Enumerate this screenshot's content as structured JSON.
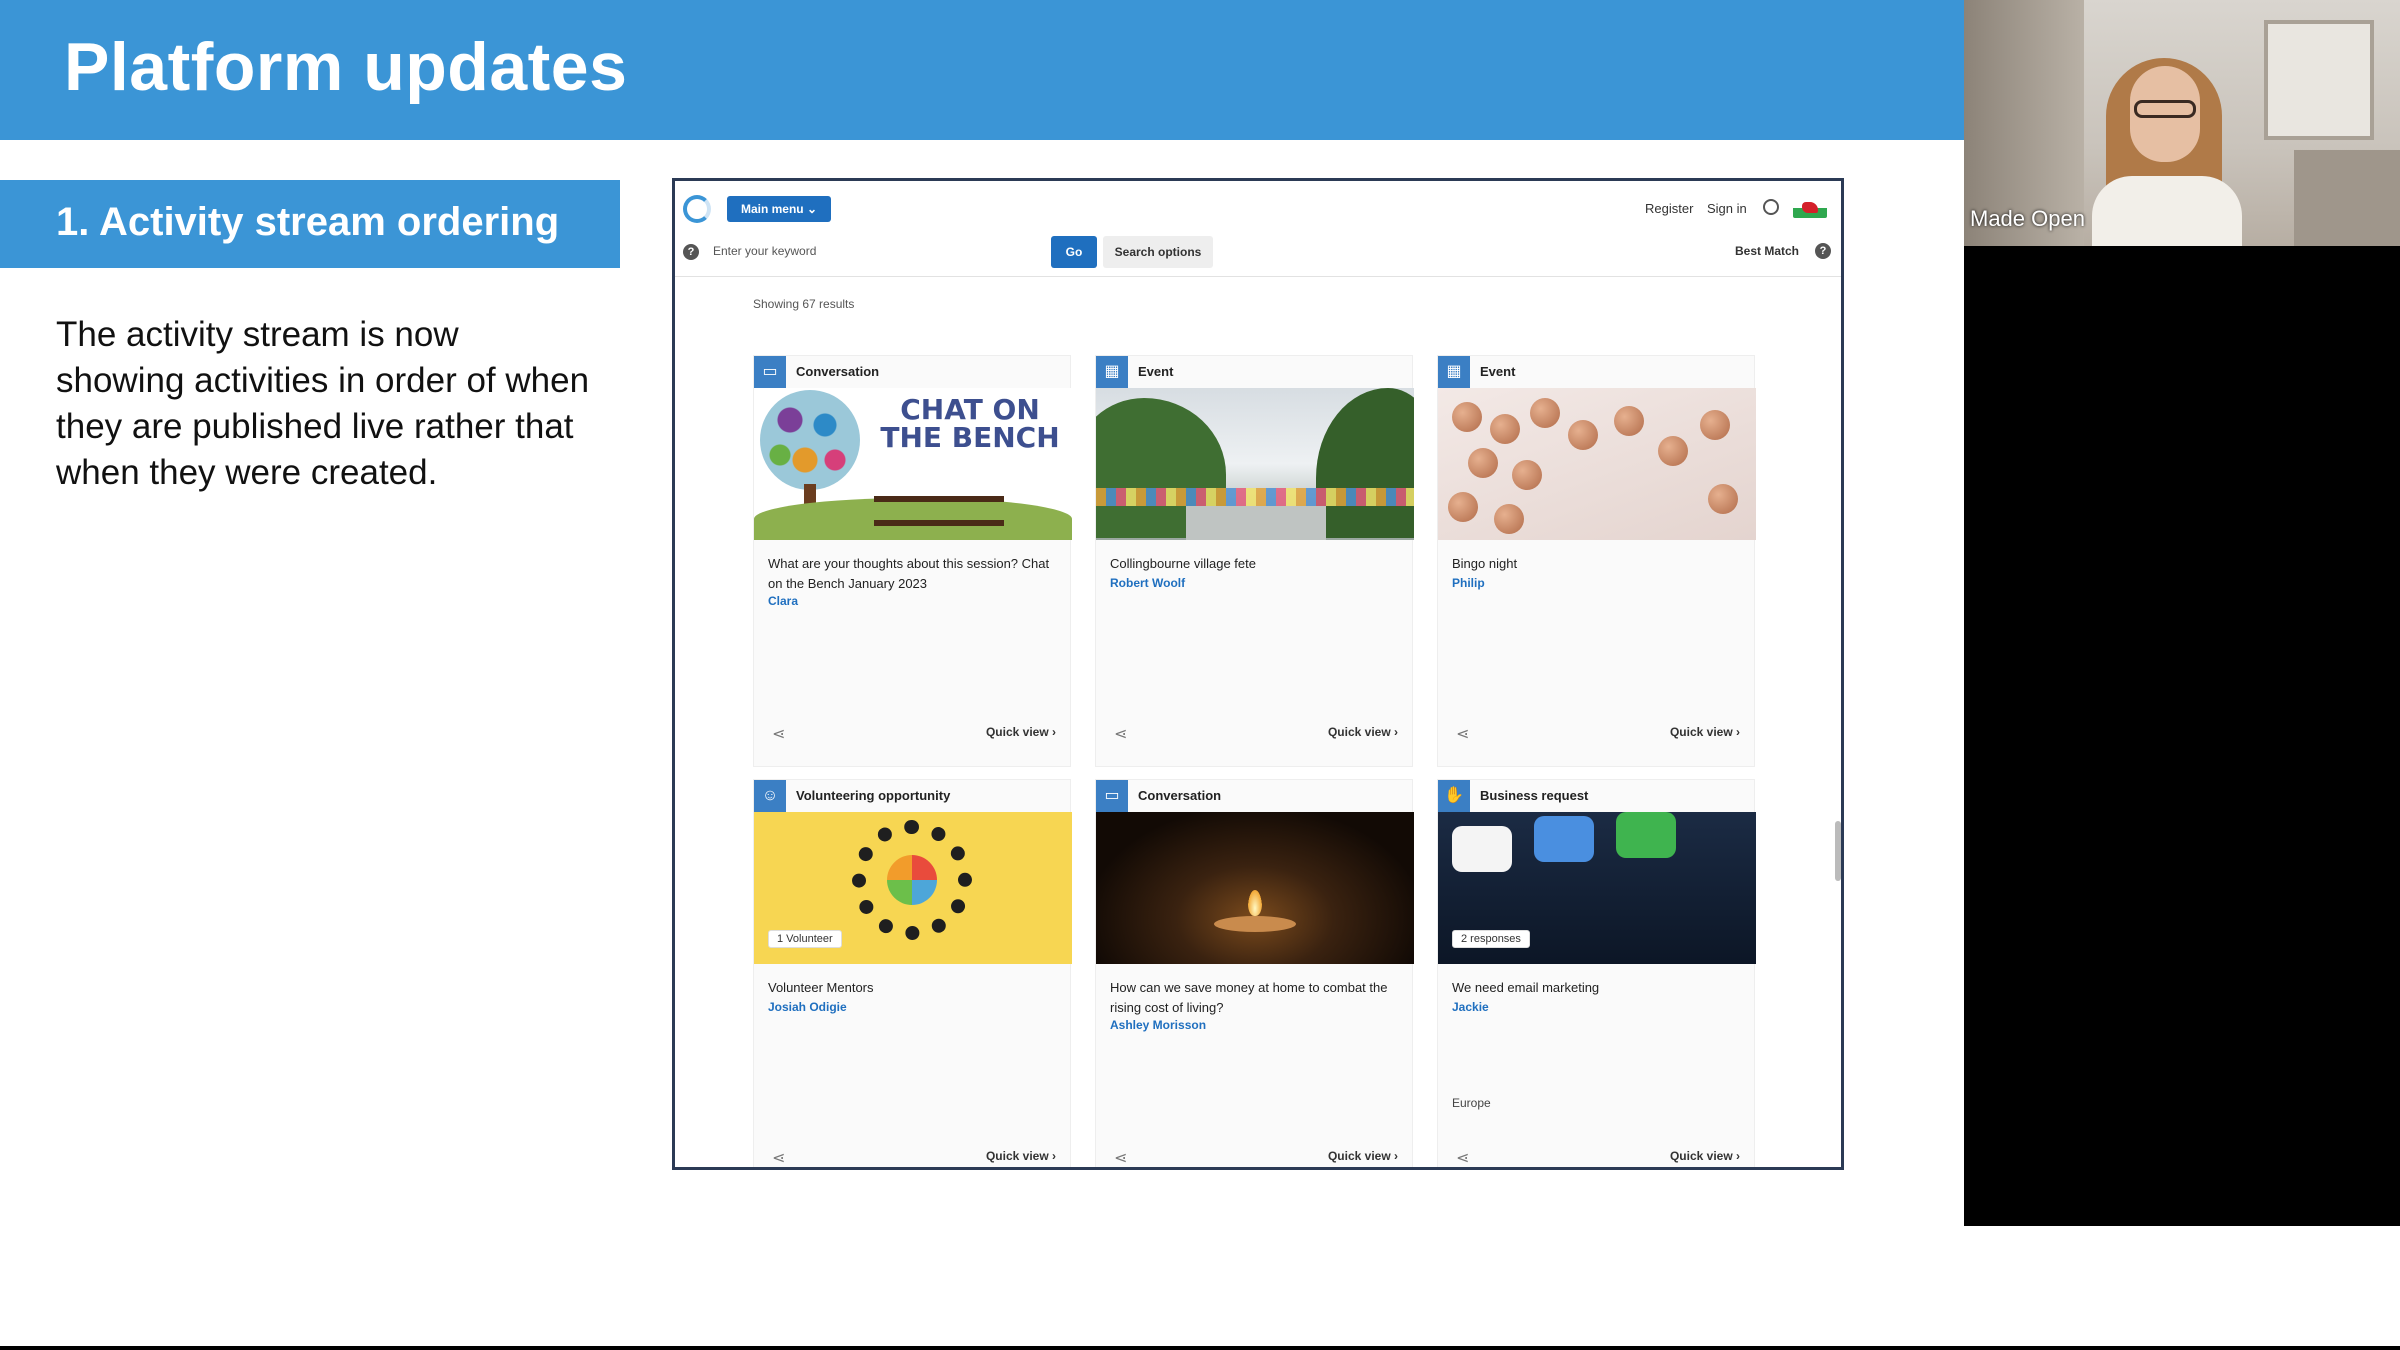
{
  "slide": {
    "title": "Platform updates",
    "section_title": "1. Activity stream ordering",
    "body": "The activity stream is now showing activities in order of when they are published live rather that when they were created."
  },
  "webcam": {
    "label": "Made Open"
  },
  "app": {
    "main_menu_label": "Main menu ⌄",
    "register_label": "Register",
    "signin_label": "Sign in",
    "search_placeholder": "Enter your keyword",
    "go_label": "Go",
    "search_options_label": "Search options",
    "sort_label": "Best Match",
    "results_label": "Showing 67 results",
    "accent_color": "#1f6fbf",
    "cards": [
      {
        "type": "Conversation",
        "type_icon": "conversation-icon",
        "image_text": "CHAT ON THE BENCH",
        "title": "What are your thoughts about this session? Chat on the Bench January 2023",
        "author": "Clara",
        "quick_view": "Quick view  ›"
      },
      {
        "type": "Event",
        "type_icon": "calendar-icon",
        "title": "Collingbourne village fete",
        "author": "Robert Woolf",
        "quick_view": "Quick view  ›"
      },
      {
        "type": "Event",
        "type_icon": "calendar-icon",
        "title": "Bingo night",
        "author": "Philip",
        "quick_view": "Quick view  ›"
      },
      {
        "type": "Volunteering opportunity",
        "type_icon": "volunteer-icon",
        "badge": "1 Volunteer",
        "title": "Volunteer Mentors",
        "author": "Josiah Odigie",
        "quick_view": "Quick view  ›"
      },
      {
        "type": "Conversation",
        "type_icon": "conversation-icon",
        "title": "How can we save money at home to combat the rising cost of living?",
        "author": "Ashley Morisson",
        "quick_view": "Quick view  ›"
      },
      {
        "type": "Business request",
        "type_icon": "handshake-icon",
        "badge": "2 responses",
        "title": "We need email marketing",
        "author": "Jackie",
        "meta": "Europe",
        "quick_view": "Quick view  ›"
      }
    ]
  }
}
